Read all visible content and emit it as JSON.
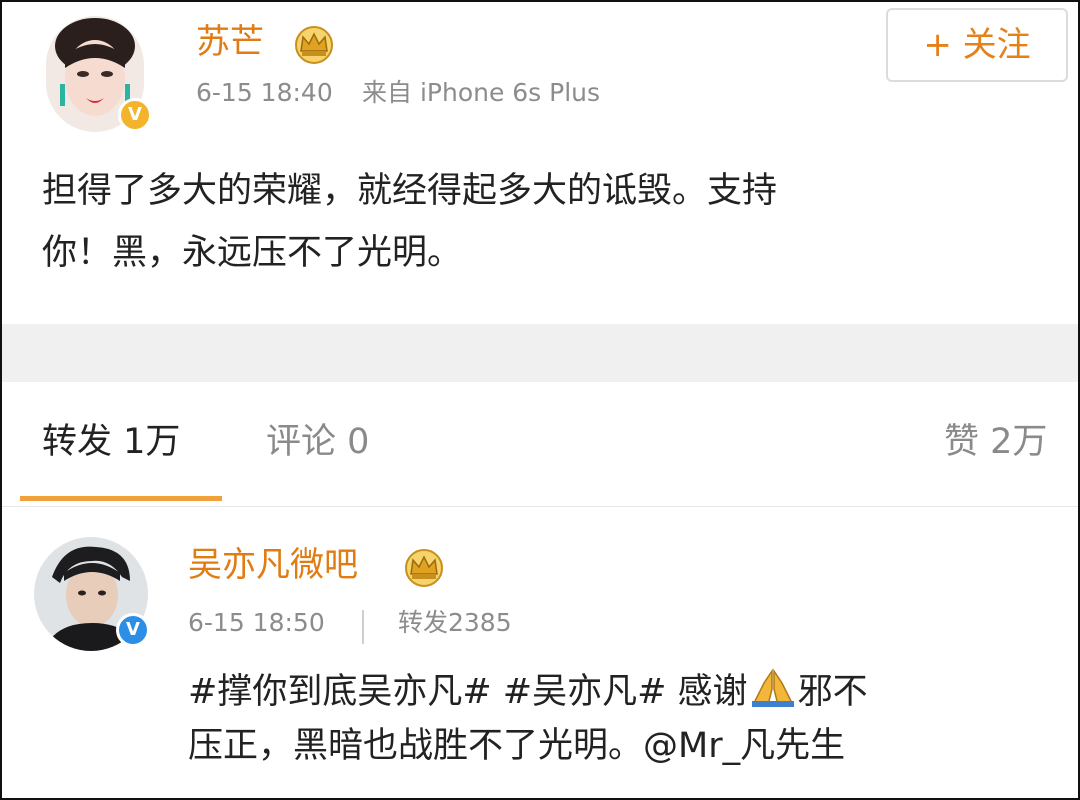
{
  "post": {
    "author": "苏芒",
    "time": "6-15 18:40",
    "source": "来自 iPhone 6s Plus",
    "follow_label": "+ 关注",
    "text_line1": "担得了多大的荣耀，就经得起多大的诋毁。支持",
    "text_line2": "你！黑，永远压不了光明。"
  },
  "tabs": {
    "repost": "转发 1万",
    "comment": "评论 0",
    "like": "赞 2万"
  },
  "repost_item": {
    "author": "吴亦凡微吧",
    "time": "6-15 18:50",
    "repost_count": "转发2385",
    "text_part1": "#撑你到底吴亦凡# #吴亦凡# 感谢",
    "text_part2": "邪不",
    "text_line2": "压正，黑暗也战胜不了光明。@Mr_凡先生"
  },
  "colors": {
    "name": "#e07c12",
    "accent_underline": "#f0a13a",
    "verified_gold": "#f3b42c",
    "verified_blue": "#2d8ee6",
    "meta_gray": "#8c8c8c"
  },
  "icons": {
    "crown": "crown-icon",
    "verified": "verified-v-icon",
    "pray": "pray-emoji-icon"
  }
}
